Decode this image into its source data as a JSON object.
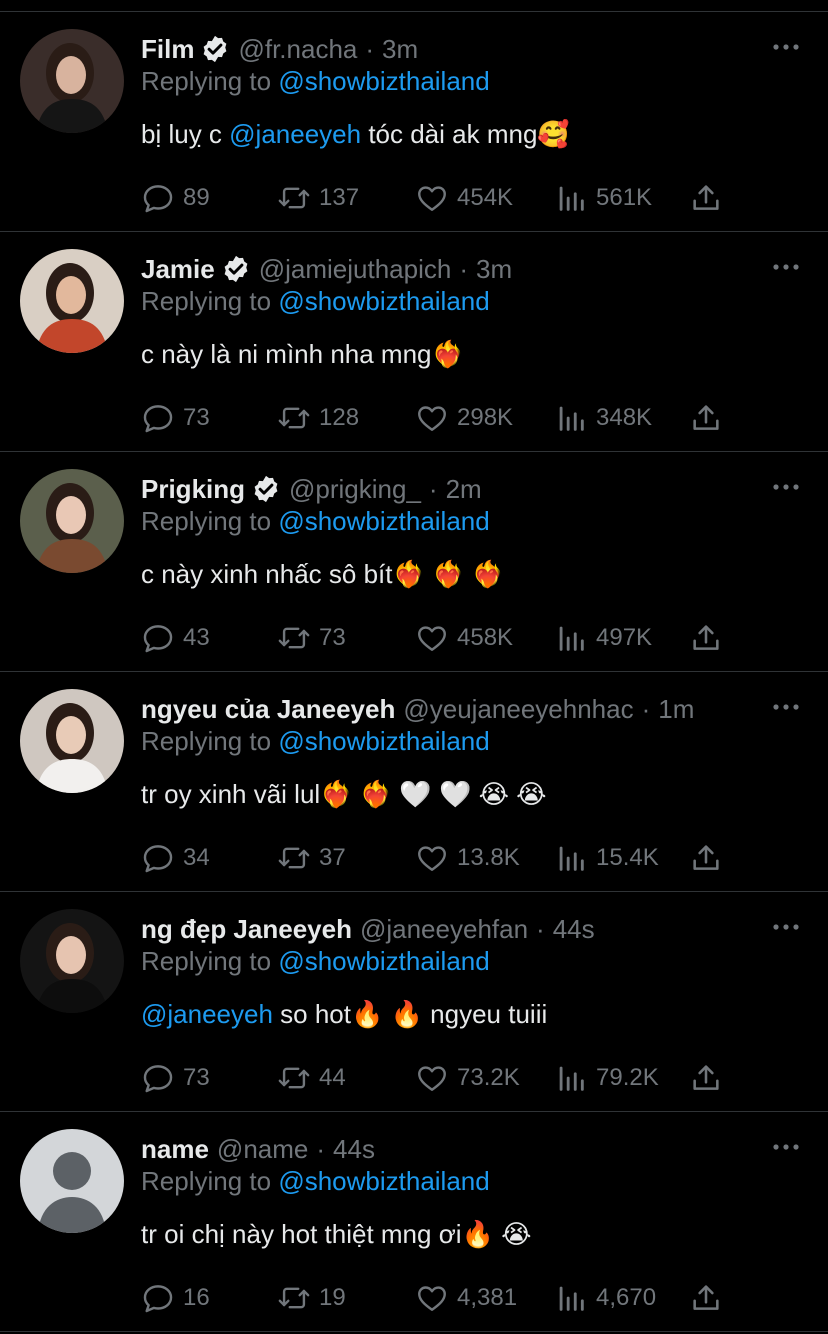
{
  "tweets": [
    {
      "name": "Film",
      "verified": true,
      "handle": "@fr.nacha",
      "time": "3m",
      "reply_prefix": "Replying to",
      "reply_to": "@showbizthailand",
      "text_parts": [
        {
          "t": "bị luỵ c "
        },
        {
          "t": "@janeeyeh",
          "m": true
        },
        {
          "t": " tóc dài ak mng🥰"
        }
      ],
      "replies": "89",
      "retweets": "137",
      "likes": "454K",
      "views": "561K",
      "avatar_colors": [
        "#3a2d2a",
        "#d8b39e",
        "#151515"
      ]
    },
    {
      "name": "Jamie",
      "verified": true,
      "handle": "@jamiejuthapich",
      "time": "3m",
      "reply_prefix": "Replying to",
      "reply_to": "@showbizthailand",
      "text_parts": [
        {
          "t": "c này là ni mình nha mng❤️‍🔥"
        }
      ],
      "replies": "73",
      "retweets": "128",
      "likes": "298K",
      "views": "348K",
      "avatar_colors": [
        "#d9cfc4",
        "#e2b89c",
        "#c2462b"
      ]
    },
    {
      "name": "Prigking",
      "verified": true,
      "handle": "@prigking_",
      "time": "2m",
      "reply_prefix": "Replying to",
      "reply_to": "@showbizthailand",
      "text_parts": [
        {
          "t": "c này xinh nhấc sô bít❤️‍🔥 ❤️‍🔥 ❤️‍🔥"
        }
      ],
      "replies": "43",
      "retweets": "73",
      "likes": "458K",
      "views": "497K",
      "avatar_colors": [
        "#5b5f4c",
        "#e9c8b5",
        "#7a4a30"
      ]
    },
    {
      "name": "ngyeu của Janeeyeh",
      "verified": false,
      "handle": "@yeujaneeyehnhac",
      "time": "1m",
      "reply_prefix": "Replying to",
      "reply_to": "@showbizthailand",
      "text_parts": [
        {
          "t": "tr oy xinh vãi lul❤️‍🔥 ❤️‍🔥 🤍 🤍 😭 😭"
        }
      ],
      "replies": "34",
      "retweets": "37",
      "likes": "13.8K",
      "views": "15.4K",
      "avatar_colors": [
        "#cfc7c0",
        "#e8cbb7",
        "#f2f0ee"
      ]
    },
    {
      "name": "ng đẹp Janeeyeh",
      "verified": false,
      "handle": "@janeeyehfan",
      "time": "44s",
      "reply_prefix": "Replying to",
      "reply_to": "@showbizthailand",
      "text_parts": [
        {
          "t": "@janeeyeh",
          "m": true
        },
        {
          "t": " so hot🔥 🔥 ngyeu tuiii"
        }
      ],
      "replies": "73",
      "retweets": "44",
      "likes": "73.2K",
      "views": "79.2K",
      "avatar_colors": [
        "#141414",
        "#e6c4b0",
        "#0d0d0d"
      ]
    },
    {
      "name": "name",
      "verified": false,
      "handle": "@name",
      "time": "44s",
      "reply_prefix": "Replying to",
      "reply_to": "@showbizthailand",
      "text_parts": [
        {
          "t": "tr oi chị này hot thiệt mng ơi🔥 😭"
        }
      ],
      "replies": "16",
      "retweets": "19",
      "likes": "4,381",
      "views": "4,670",
      "default_avatar": true
    }
  ],
  "colors": {
    "background": "#000000",
    "text": "#e7e9ea",
    "muted": "#71767b",
    "link": "#1d9bf0",
    "divider": "#2f3336"
  }
}
